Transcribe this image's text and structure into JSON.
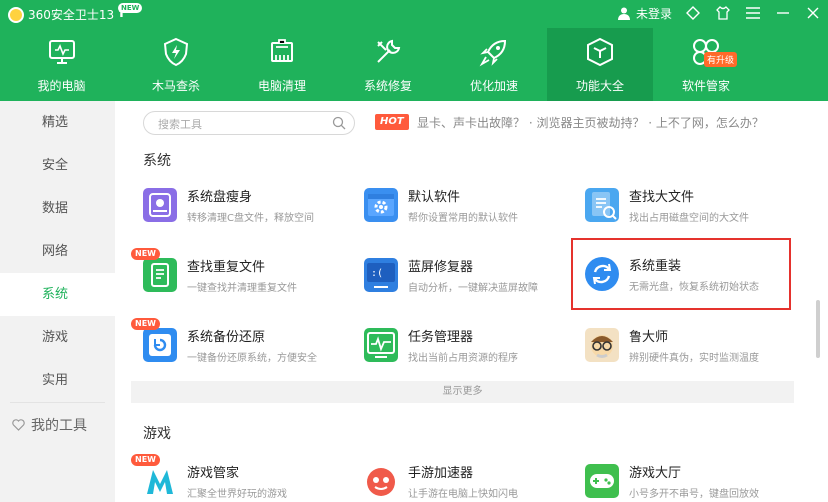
{
  "app": {
    "title": "360安全卫士13",
    "update_badge": "NEW"
  },
  "window": {
    "login": "未登录"
  },
  "nav": [
    {
      "label": "我的电脑",
      "icon": "monitor-icon"
    },
    {
      "label": "木马查杀",
      "icon": "shield-icon"
    },
    {
      "label": "电脑清理",
      "icon": "broom-icon"
    },
    {
      "label": "系统修复",
      "icon": "wrench-icon"
    },
    {
      "label": "优化加速",
      "icon": "rocket-icon"
    },
    {
      "label": "功能大全",
      "icon": "cube-icon",
      "active": true
    },
    {
      "label": "软件管家",
      "icon": "butterfly-icon",
      "badge": "有升级"
    }
  ],
  "sidebar": {
    "items": [
      "精选",
      "安全",
      "数据",
      "网络",
      "系统",
      "游戏",
      "实用"
    ],
    "active": "系统",
    "my_tools": "我的工具"
  },
  "search": {
    "placeholder": "搜索工具"
  },
  "hot": {
    "tag": "HOT",
    "text": "显卡、声卡出故障？ · 浏览器主页被劫持？ · 上不了网，怎么办？"
  },
  "sections": {
    "system": {
      "title": "系统",
      "tools": [
        {
          "title": "系统盘瘦身",
          "desc": "转移清理C盘文件，释放空间",
          "icon": "disk-icon"
        },
        {
          "title": "默认软件",
          "desc": "帮你设置常用的默认软件",
          "icon": "gear-window-icon"
        },
        {
          "title": "查找大文件",
          "desc": "找出占用磁盘空间的大文件",
          "icon": "file-search-icon"
        },
        {
          "title": "查找重复文件",
          "desc": "一键查找并清理重复文件",
          "icon": "duplicate-file-icon",
          "tag": "NEW"
        },
        {
          "title": "蓝屏修复器",
          "desc": "自动分析，一键解决蓝屏故障",
          "icon": "bluescreen-icon"
        },
        {
          "title": "系统重装",
          "desc": "无需光盘，恢复系统初始状态",
          "icon": "refresh-icon"
        },
        {
          "title": "系统备份还原",
          "desc": "一键备份还原系统，方便安全",
          "icon": "backup-icon",
          "tag": "NEW"
        },
        {
          "title": "任务管理器",
          "desc": "找出当前占用资源的程序",
          "icon": "task-monitor-icon"
        },
        {
          "title": "鲁大师",
          "desc": "辨别硬件真伪，实时监测温度",
          "icon": "ludashi-icon"
        }
      ],
      "show_more": "显示更多"
    },
    "games": {
      "title": "游戏",
      "tools": [
        {
          "title": "游戏管家",
          "desc": "汇聚全世界好玩的游戏",
          "icon": "game-manager-icon",
          "tag": "NEW"
        },
        {
          "title": "手游加速器",
          "desc": "让手游在电脑上快如闪电",
          "icon": "mobile-game-icon"
        },
        {
          "title": "游戏大厅",
          "desc": "小号多开不串号，键盘回放效",
          "icon": "gamepad-icon"
        }
      ]
    }
  },
  "colors": {
    "brand": "#1fb25b",
    "brand_active": "#179c4e",
    "highlight": "#e5322d",
    "hot": "#ff5a3c"
  }
}
